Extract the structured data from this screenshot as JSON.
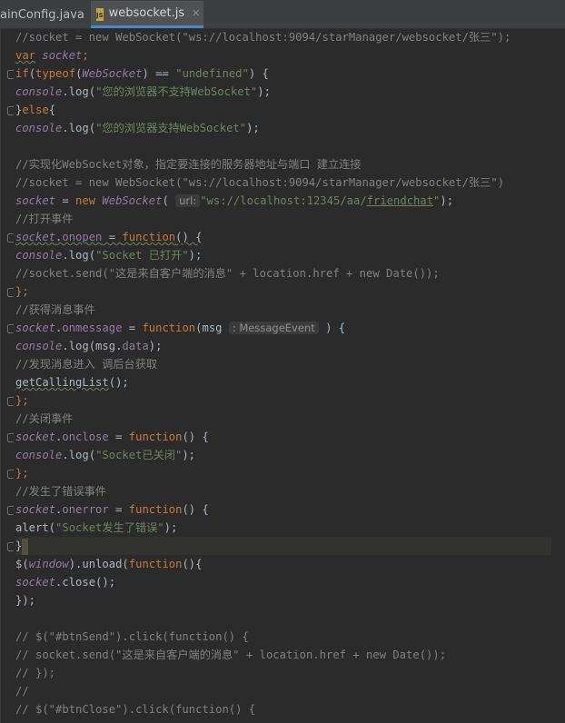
{
  "tabs": [
    {
      "label": "ainConfig.java",
      "close": "✕"
    },
    {
      "label": "websocket.js",
      "badge": "JS",
      "close": "✕"
    }
  ],
  "code": {
    "l1": "//socket = new WebSocket(\"ws://localhost:9094/starManager/websocket/张三\");",
    "l2a": "var",
    "l2b": "socket",
    "l3a": "if",
    "l3b": "(",
    "l3c": "typeof",
    "l3d": "(",
    "l3e": "WebSocket",
    "l3f": ") == ",
    "l3g": "\"undefined\"",
    "l3h": ") {",
    "l4a": "console",
    "l4b": ".log(",
    "l4c": "\"您的浏览器不支持WebSocket\"",
    "l4d": ");",
    "l5a": "}",
    "l5b": "else",
    "l5c": "{",
    "l6a": "console",
    "l6b": ".log(",
    "l6c": "\"您的浏览器支持WebSocket\"",
    "l6d": ");",
    "l8": "//实现化WebSocket对象，指定要连接的服务器地址与端口 建立连接",
    "l9": "//socket = new WebSocket(\"ws://localhost:9094/starManager/websocket/张三\")",
    "l10a": "socket",
    "l10b": " = ",
    "l10c": "new",
    "l10d": "WebSocket",
    "l10e": "(",
    "l10hint": "url:",
    "l10f": "\"ws://localhost:12345/aa/",
    "l10g": "friendchat",
    "l10h": "\"",
    "l10i": ");",
    "l11": "//打开事件",
    "l12a": "socket",
    "l12b": ".",
    "l12c": "onopen",
    "l12d": " = ",
    "l12e": "function",
    "l12f": "() {",
    "l13a": "console",
    "l13b": ".log(",
    "l13c": "\"Socket 已打开\"",
    "l13d": ");",
    "l14": "//socket.send(\"这是来自客户端的消息\" + location.href + new Date());",
    "l15": "};",
    "l16": "//获得消息事件",
    "l17a": "socket",
    "l17b": ".",
    "l17c": "onmessage",
    "l17d": " = ",
    "l17e": "function",
    "l17f": "(msg",
    "l17hint": ": MessageEvent",
    "l17g": ") {",
    "l18a": "console",
    "l18b": ".log(msg.",
    "l18c": "data",
    "l18d": ");",
    "l19": "//发现消息进入 调后台获取",
    "l20a": "getCallingList",
    "l20b": "();",
    "l21": "};",
    "l22": "//关闭事件",
    "l23a": "socket",
    "l23b": ".",
    "l23c": "onclose",
    "l23d": " = ",
    "l23e": "function",
    "l23f": "() {",
    "l24a": "console",
    "l24b": ".log(",
    "l24c": "\"Socket已关闭\"",
    "l24d": ");",
    "l25": "};",
    "l26": "//发生了错误事件",
    "l27a": "socket",
    "l27b": ".",
    "l27c": "onerror",
    "l27d": " = ",
    "l27e": "function",
    "l27f": "() {",
    "l28a": "alert(",
    "l28b": "\"Socket发生了错误\"",
    "l28c": ");",
    "l29": "}",
    "l30a": "$(",
    "l30b": "window",
    "l30c": ").unload(",
    "l30d": "function",
    "l30e": "(){",
    "l31a": "socket",
    "l31b": ".close();",
    "l32": "});",
    "l35": "// $(\"#btnSend\").click(function() {",
    "l36": "// socket.send(\"这是来自客户端的消息\" + location.href + new Date());",
    "l37": "// });",
    "l38": "//",
    "l39": "// $(\"#btnClose\").click(function() {"
  },
  "colors": {
    "background": "#2b2b2b",
    "comment": "#808080",
    "keyword": "#cc7832",
    "string": "#6a8759",
    "variable": "#9876aa",
    "function": "#ffc66d",
    "text": "#a9b7c6"
  }
}
